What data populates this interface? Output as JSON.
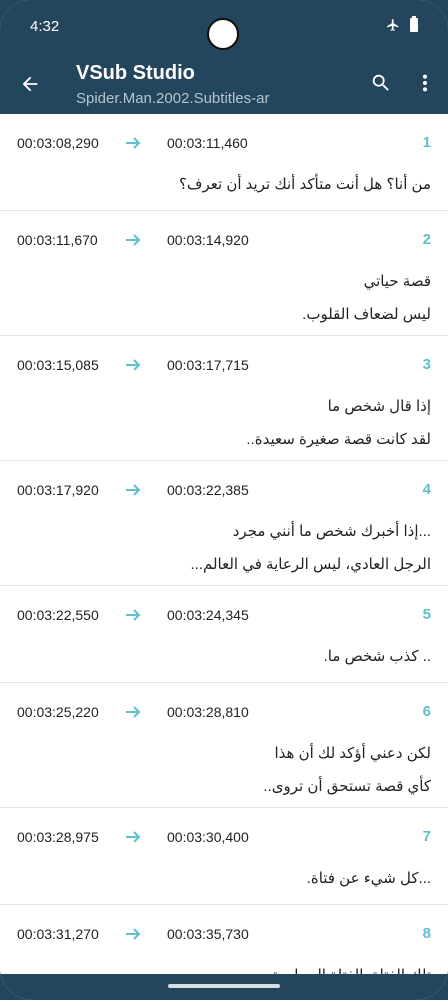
{
  "status_bar": {
    "time": "4:32",
    "icons": [
      "airplane-icon",
      "battery-icon"
    ]
  },
  "app_bar": {
    "title": "VSub Studio",
    "subtitle": "Spider.Man.2002.Subtitles-ar",
    "icons": [
      "back-arrow-icon",
      "search-icon",
      "more-vert-icon"
    ]
  },
  "colors": {
    "header": "#23465c",
    "accent": "#5fc0c9",
    "text": "#222222"
  },
  "subtitles": [
    {
      "index": "1",
      "start": "00:03:08,290",
      "end": "00:03:11,460",
      "lines": [
        "من أنا؟ هل أنت متأكد أنك تريد أن تعرف؟"
      ]
    },
    {
      "index": "2",
      "start": "00:03:11,670",
      "end": "00:03:14,920",
      "lines": [
        "قصة حياتي",
        "ليس لضعاف القلوب."
      ]
    },
    {
      "index": "3",
      "start": "00:03:15,085",
      "end": "00:03:17,715",
      "lines": [
        "إذا قال شخص ما",
        "لقد كانت قصة صغيرة سعيدة.."
      ]
    },
    {
      "index": "4",
      "start": "00:03:17,920",
      "end": "00:03:22,385",
      "lines": [
        "...إذا أخبرك شخص ما أنني مجرد",
        "الرجل العادي، ليس الرعاية في العالم..."
      ]
    },
    {
      "index": "5",
      "start": "00:03:22,550",
      "end": "00:03:24,345",
      "lines": [
        ".. كذب شخص ما."
      ]
    },
    {
      "index": "6",
      "start": "00:03:25,220",
      "end": "00:03:28,810",
      "lines": [
        "لكن دعني أؤكد لك أن هذا",
        "كأي قصة تستحق أن تروى.."
      ]
    },
    {
      "index": "7",
      "start": "00:03:28,975",
      "end": "00:03:30,400",
      "lines": [
        "...كل شيء عن فتاة."
      ]
    },
    {
      "index": "8",
      "start": "00:03:31,270",
      "end": "00:03:35,730",
      "lines": [
        "تلك الفتاة. الفتاة المجاورة."
      ]
    }
  ]
}
